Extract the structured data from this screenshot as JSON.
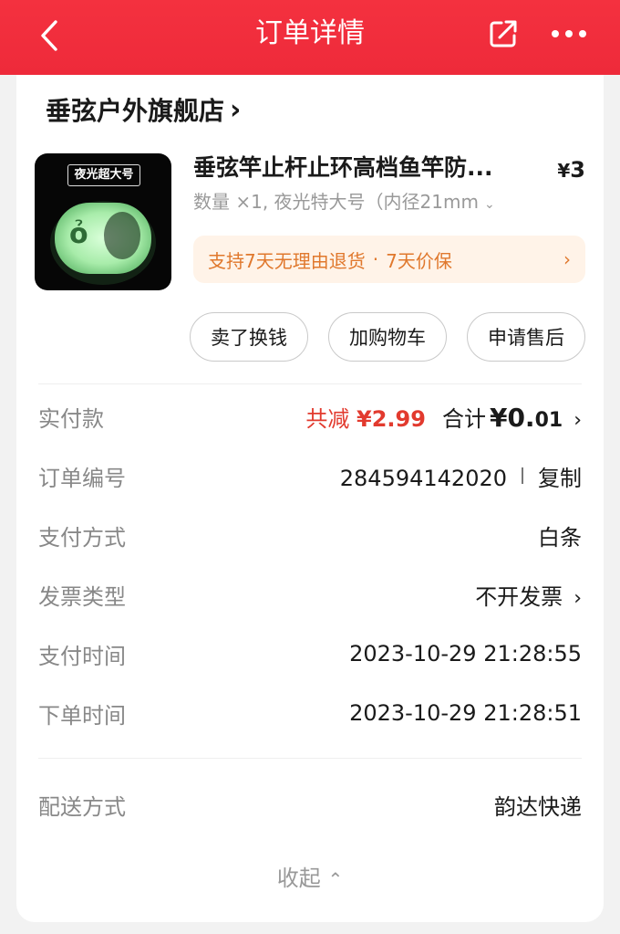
{
  "header": {
    "title": "订单详情",
    "background": "#f0303e"
  },
  "store": {
    "name": "垂弦户外旗舰店",
    "chevron": "›"
  },
  "product": {
    "image_tag": "夜光超大号",
    "title": "垂弦竿止杆止环高档鱼竿防...",
    "price_symbol": "¥",
    "price": "3",
    "spec": "数量 ×1, 夜光特大号（内径21mm",
    "spec_caret": "⌄",
    "promise_return": "支持7天无理由退货",
    "promise_dot": "·",
    "promise_price": "7天价保",
    "promise_arrow": "›"
  },
  "actions": {
    "sell": "卖了换钱",
    "cart": "加购物车",
    "after_sale": "申请售后"
  },
  "details": {
    "paid": {
      "label": "实付款",
      "discount_label": "共减",
      "discount_amount": "¥2.99",
      "total_label": "合计",
      "total_symbol": "¥",
      "total_int": "0.",
      "total_dec": "01",
      "chevron": "›"
    },
    "order_no": {
      "label": "订单编号",
      "value": "284594142020",
      "copy": "复制"
    },
    "pay_method": {
      "label": "支付方式",
      "value": "白条"
    },
    "invoice": {
      "label": "发票类型",
      "value": "不开发票",
      "chevron": "›"
    },
    "pay_time": {
      "label": "支付时间",
      "value": "2023-10-29 21:28:55"
    },
    "order_time": {
      "label": "下单时间",
      "value": "2023-10-29 21:28:51"
    },
    "delivery": {
      "label": "配送方式",
      "value": "韵达快递"
    }
  },
  "collapse": {
    "label": "收起",
    "icon": "⌃"
  },
  "colors": {
    "accent_red": "#e23a2e",
    "promise_orange": "#e0782d",
    "glow_green": "#b6f2b6"
  }
}
